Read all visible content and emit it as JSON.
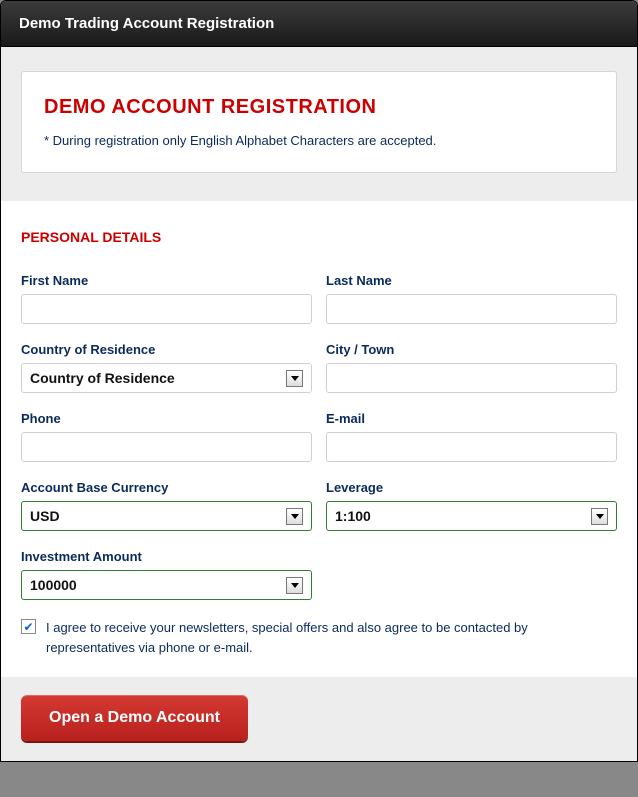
{
  "window": {
    "title": "Demo Trading Account Registration"
  },
  "header_card": {
    "title": "DEMO ACCOUNT REGISTRATION",
    "note": "* During registration only English Alphabet Characters are accepted."
  },
  "section": {
    "title": "PERSONAL DETAILS"
  },
  "fields": {
    "first_name": {
      "label": "First Name",
      "value": ""
    },
    "last_name": {
      "label": "Last Name",
      "value": ""
    },
    "country": {
      "label": "Country of Residence",
      "selected": "Country of Residence"
    },
    "city": {
      "label": "City / Town",
      "value": ""
    },
    "phone": {
      "label": "Phone",
      "value": ""
    },
    "email": {
      "label": "E-mail",
      "value": ""
    },
    "currency": {
      "label": "Account Base Currency",
      "selected": "USD"
    },
    "leverage": {
      "label": "Leverage",
      "selected": "1:100"
    },
    "investment": {
      "label": "Investment Amount",
      "selected": "100000"
    }
  },
  "consent": {
    "checked": true,
    "text": "I agree to receive your newsletters, special offers and also agree to be contacted by representatives via phone or e-mail."
  },
  "submit": {
    "label": "Open a Demo Account"
  }
}
